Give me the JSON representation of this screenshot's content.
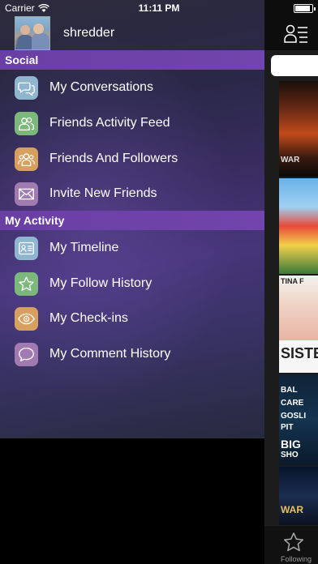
{
  "status_bar": {
    "carrier": "Carrier",
    "time": "11:11 PM"
  },
  "profile": {
    "username": "shredder"
  },
  "sections": [
    {
      "header": "Social",
      "items": [
        {
          "label": "My Conversations",
          "icon": "conversations-icon",
          "color": "#8fb5cf"
        },
        {
          "label": "Friends Activity Feed",
          "icon": "friends-icon",
          "color": "#7cb87c"
        },
        {
          "label": "Friends And Followers",
          "icon": "group-icon",
          "color": "#d7a05f"
        },
        {
          "label": "Invite New Friends",
          "icon": "envelope-icon",
          "color": "#a27ab2"
        }
      ]
    },
    {
      "header": "My Activity",
      "items": [
        {
          "label": "My Timeline",
          "icon": "timeline-card-icon",
          "color": "#8fb5cf"
        },
        {
          "label": "My Follow History",
          "icon": "star-icon",
          "color": "#7cb87c"
        },
        {
          "label": "My Check-ins",
          "icon": "eye-icon",
          "color": "#d7a05f"
        },
        {
          "label": "My Comment History",
          "icon": "speech-bubble-icon",
          "color": "#a27ab2"
        }
      ]
    }
  ],
  "background_screen": {
    "posters": [
      {
        "name": "star-wars-poster",
        "text": "WAR"
      },
      {
        "name": "angry-birds-poster",
        "text": ""
      },
      {
        "name": "sisters-poster",
        "text": "TINA F"
      },
      {
        "name": "sisters-poster-title",
        "text": "SISTE"
      },
      {
        "name": "big-short-poster",
        "text": "BAL"
      },
      {
        "name": "big-short-poster-2",
        "text": "CARE"
      },
      {
        "name": "big-short-poster-3",
        "text": "GOSLI"
      },
      {
        "name": "big-short-poster-4",
        "text": "PIT"
      },
      {
        "name": "big-short-title",
        "text": "BIG"
      },
      {
        "name": "big-short-title-2",
        "text": "SHO"
      },
      {
        "name": "star-wars-poster-2",
        "text": "WAR"
      }
    ],
    "tab_label": "Following"
  }
}
